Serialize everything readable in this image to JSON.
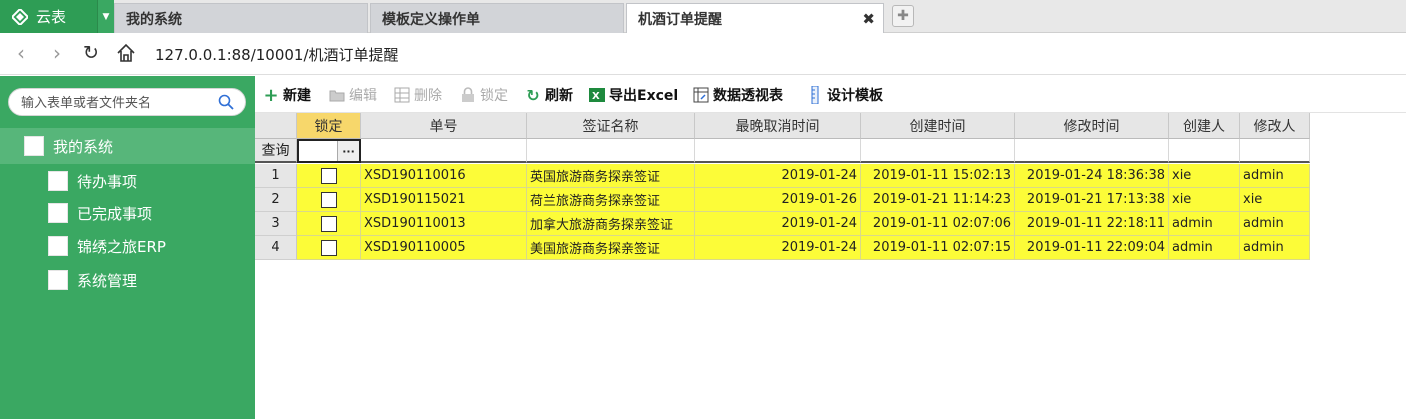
{
  "app": {
    "logo_text": "云表"
  },
  "tabs": [
    {
      "label": "我的系统"
    },
    {
      "label": "模板定义操作单"
    },
    {
      "label": "机酒订单提醒"
    }
  ],
  "address": {
    "url": "127.0.0.1:88/10001/机酒订单提醒"
  },
  "sidebar": {
    "search_placeholder": "输入表单或者文件夹名",
    "root": "我的系统",
    "items": [
      "待办事项",
      "已完成事项",
      "锦绣之旅ERP",
      "系统管理"
    ]
  },
  "toolbar": {
    "new": "新建",
    "edit": "编辑",
    "delete": "删除",
    "lock": "锁定",
    "refresh": "刷新",
    "export": "导出Excel",
    "pivot": "数据透视表",
    "design": "设计模板"
  },
  "grid": {
    "query_label": "查询",
    "columns": [
      "锁定",
      "单号",
      "签证名称",
      "最晚取消时间",
      "创建时间",
      "修改时间",
      "创建人",
      "修改人"
    ],
    "rows": [
      {
        "num": "1",
        "order_no": "XSD190110016",
        "visa": "英国旅游商务探亲签证",
        "cancel": "2019-01-24",
        "created": "2019-01-11 15:02:13",
        "modified": "2019-01-24 18:36:38",
        "creator": "xie",
        "modifier": "admin"
      },
      {
        "num": "2",
        "order_no": "XSD190115021",
        "visa": "荷兰旅游商务探亲签证",
        "cancel": "2019-01-26",
        "created": "2019-01-21 11:14:23",
        "modified": "2019-01-21 17:13:38",
        "creator": "xie",
        "modifier": "xie"
      },
      {
        "num": "3",
        "order_no": "XSD190110013",
        "visa": "加拿大旅游商务探亲签证",
        "cancel": "2019-01-24",
        "created": "2019-01-11 02:07:06",
        "modified": "2019-01-11 22:18:11",
        "creator": "admin",
        "modifier": "admin"
      },
      {
        "num": "4",
        "order_no": "XSD190110005",
        "visa": "美国旅游商务探亲签证",
        "cancel": "2019-01-24",
        "created": "2019-01-11 02:07:15",
        "modified": "2019-01-11 22:09:04",
        "creator": "admin",
        "modifier": "admin"
      }
    ]
  },
  "colors": {
    "brand": "#3aa862",
    "row_highlight": "#fcfc38",
    "lock_header": "#f7d76b"
  }
}
